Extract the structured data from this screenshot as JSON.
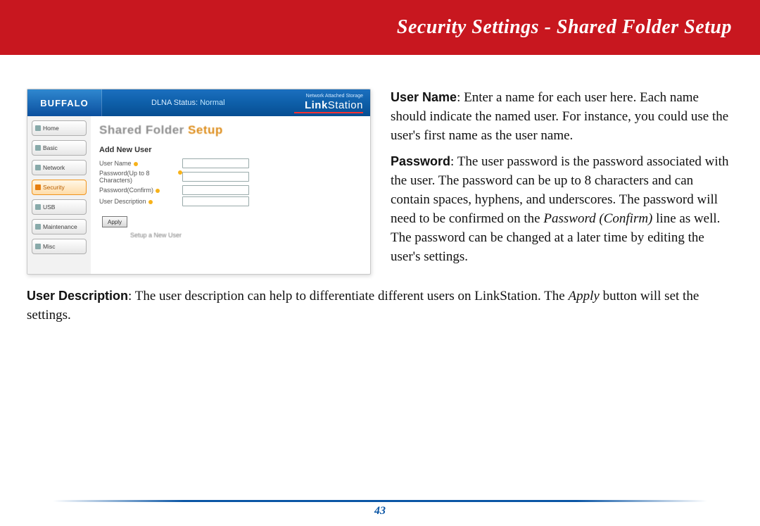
{
  "header": {
    "title": "Security Settings - Shared Folder Setup"
  },
  "screenshot": {
    "brand": "BUFFALO",
    "dlna_label": "DLNA Status:",
    "dlna_value": "Normal",
    "product_sub": "Network Attached Storage",
    "product_main_a": "Link",
    "product_main_b": "Station",
    "sidebar": {
      "items": [
        "Home",
        "Basic",
        "Network",
        "Security",
        "USB",
        "Maintenance",
        "Misc"
      ]
    },
    "main": {
      "title_grey": "Shared Folder ",
      "title_orange": "Setup",
      "subheading": "Add New User",
      "fields": {
        "user_name": "User Name",
        "password": "Password(Up to 8 Characters)",
        "password_confirm": "Password(Confirm)",
        "user_desc": "User Description"
      },
      "apply_label": "Apply",
      "caption": "Setup a New User"
    }
  },
  "explain": {
    "p1_label": "User Name",
    "p1_body": ":  Enter a name for each user here.  Each name should indicate the named user.  For instance, you could use the user's first name as the user name.",
    "p2_label": "Password",
    "p2_body_a": ":  The user password is the password associated with the user.  The password can be up to 8 characters and can contain spaces, hyphens, and underscores.  The password will need to be confirmed on the ",
    "p2_italic": "Password (Confirm)",
    "p2_body_b": " line as well.  The password can be changed at a later time by editing the user's settings.",
    "p3_label": "User Description",
    "p3_body_a": ":  The user description can help to differentiate different users on LinkStation.  The ",
    "p3_italic": "Apply",
    "p3_body_b": " button will set the settings."
  },
  "footer": {
    "page_number": "43"
  }
}
